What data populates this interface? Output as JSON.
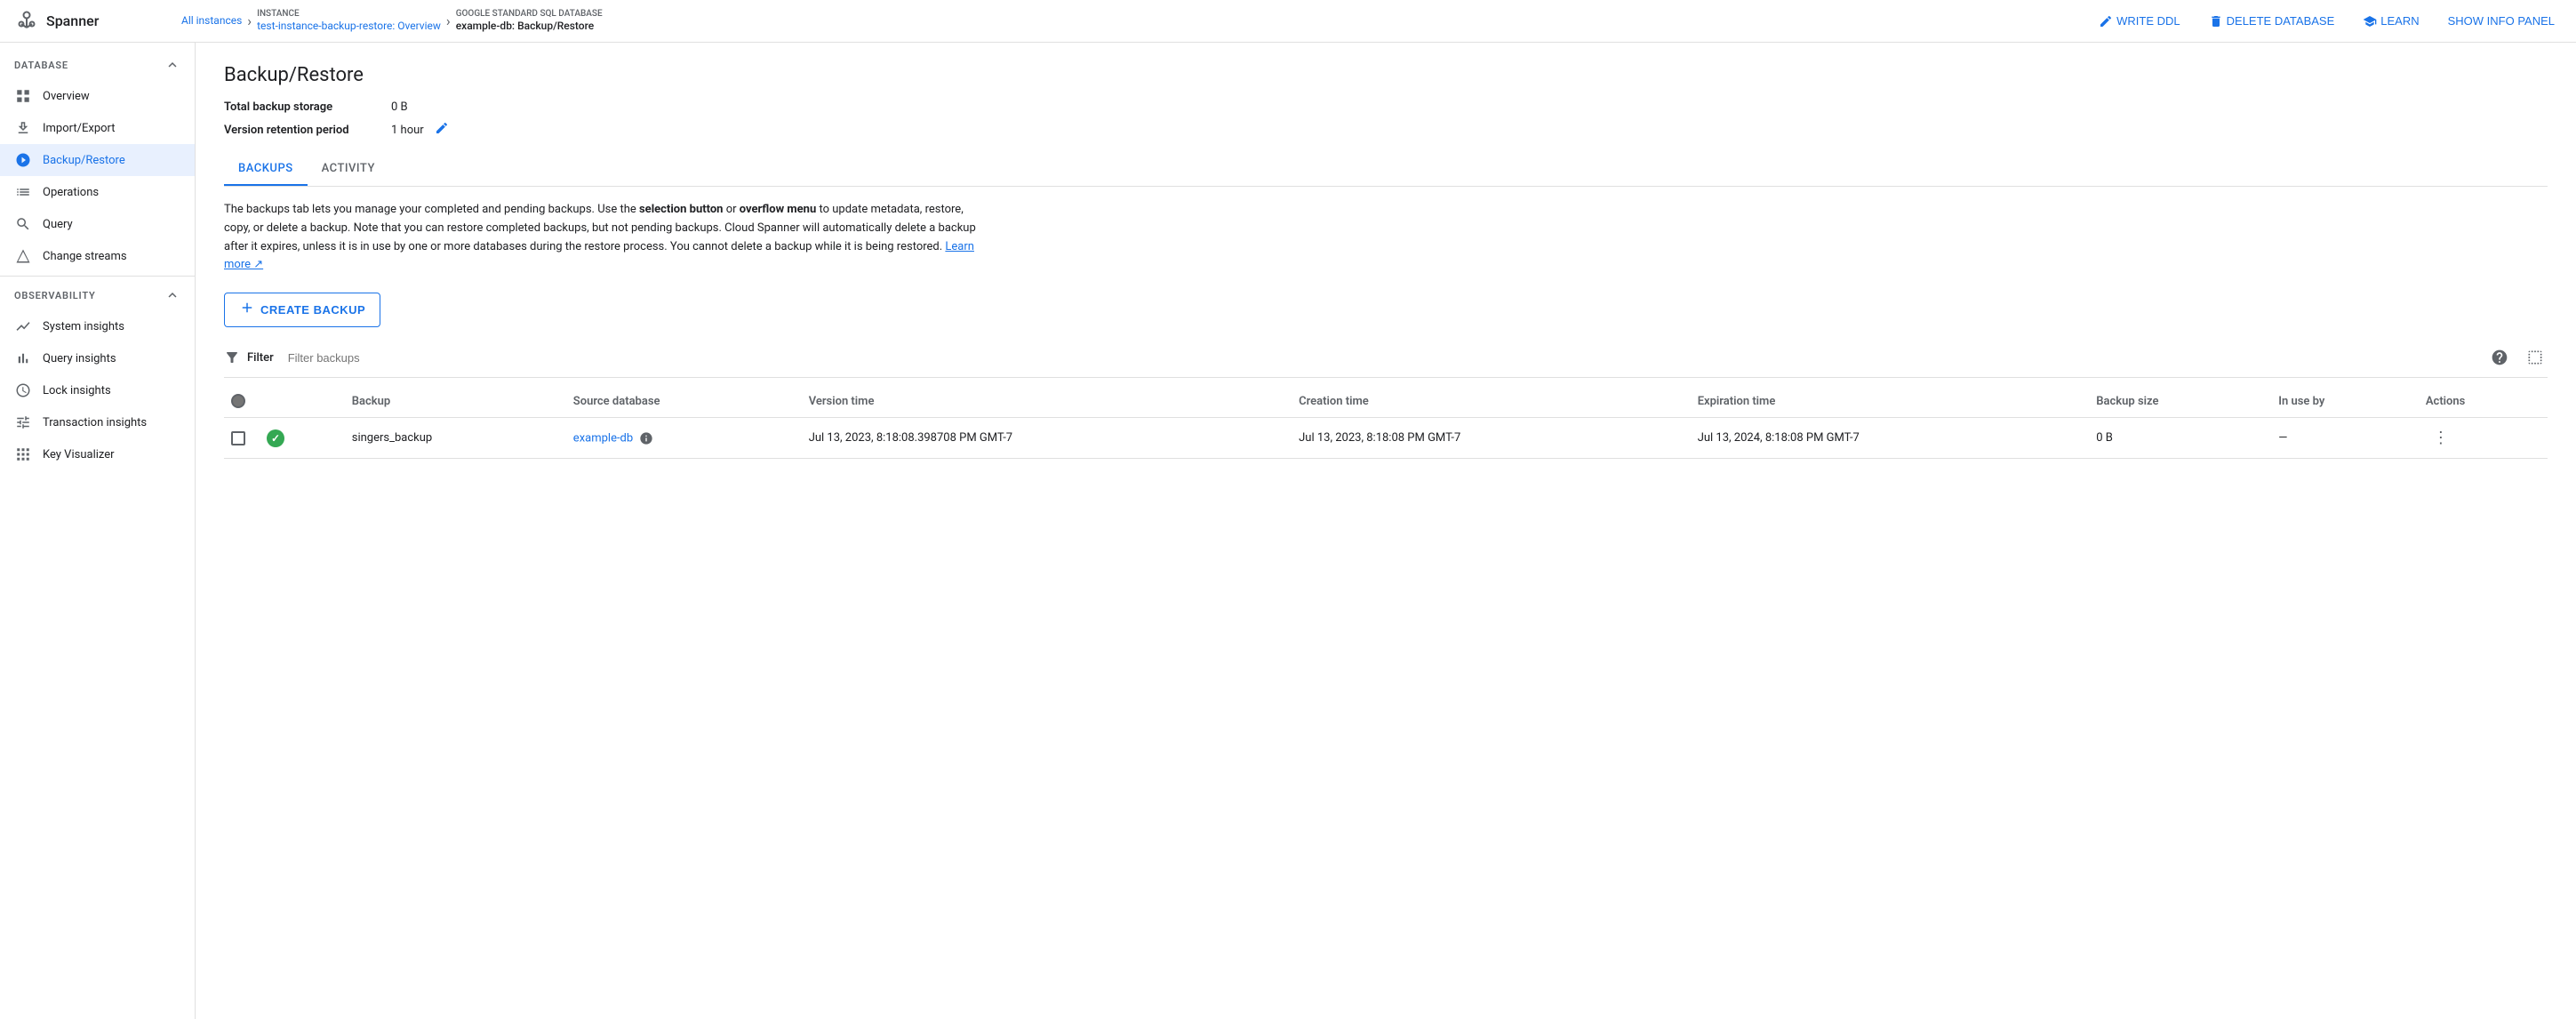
{
  "app": {
    "name": "Spanner"
  },
  "topnav": {
    "breadcrumb": {
      "all_instances_label": "All instances",
      "instance_section_label": "INSTANCE",
      "instance_name": "test-instance-backup-restore: Overview",
      "database_section_label": "GOOGLE STANDARD SQL DATABASE",
      "database_name": "example-db: Backup/Restore"
    },
    "actions": {
      "write_ddl": "WRITE DDL",
      "delete_database": "DELETE DATABASE",
      "learn": "LEARN",
      "show_info_panel": "SHOW INFO PANEL"
    }
  },
  "sidebar": {
    "database_section": "DATABASE",
    "observability_section": "OBSERVABILITY",
    "items_database": [
      {
        "id": "overview",
        "label": "Overview",
        "icon": "grid-icon"
      },
      {
        "id": "import-export",
        "label": "Import/Export",
        "icon": "upload-icon"
      },
      {
        "id": "backup-restore",
        "label": "Backup/Restore",
        "icon": "database-icon",
        "active": true
      },
      {
        "id": "operations",
        "label": "Operations",
        "icon": "list-icon"
      },
      {
        "id": "query",
        "label": "Query",
        "icon": "search-icon"
      },
      {
        "id": "change-streams",
        "label": "Change streams",
        "icon": "triangle-icon"
      }
    ],
    "items_observability": [
      {
        "id": "system-insights",
        "label": "System insights",
        "icon": "chart-icon"
      },
      {
        "id": "query-insights",
        "label": "Query insights",
        "icon": "bar-chart-icon"
      },
      {
        "id": "lock-insights",
        "label": "Lock insights",
        "icon": "clock-icon"
      },
      {
        "id": "transaction-insights",
        "label": "Transaction insights",
        "icon": "sliders-icon"
      },
      {
        "id": "key-visualizer",
        "label": "Key Visualizer",
        "icon": "grid-small-icon"
      }
    ]
  },
  "page": {
    "title": "Backup/Restore",
    "meta": {
      "total_backup_label": "Total backup storage",
      "total_backup_value": "0 B",
      "version_retention_label": "Version retention period",
      "version_retention_value": "1 hour"
    },
    "tabs": [
      {
        "id": "backups",
        "label": "BACKUPS",
        "active": true
      },
      {
        "id": "activity",
        "label": "ACTIVITY",
        "active": false
      }
    ],
    "info_text_part1": "The backups tab lets you manage your completed and pending backups. Use the ",
    "info_bold1": "selection button",
    "info_text_part2": " or ",
    "info_bold2": "overflow menu",
    "info_text_part3": " to update metadata, restore, copy, or delete a backup. Note that you can restore completed backups, but not pending backups. Cloud Spanner will automatically delete a backup after it expires, unless it is in use by one or more databases during the restore process. You cannot delete a backup while it is being restored. ",
    "info_learn_more": "Learn more",
    "create_backup_label": "CREATE BACKUP",
    "filter": {
      "label": "Filter",
      "placeholder": "Filter backups"
    },
    "table": {
      "columns": [
        "Backup",
        "Source database",
        "Version time",
        "Creation time",
        "Expiration time",
        "Backup size",
        "In use by",
        "Actions"
      ],
      "rows": [
        {
          "id": "singers_backup",
          "backup_name": "singers_backup",
          "source_database": "example-db",
          "version_time": "Jul 13, 2023, 8:18:08.398708 PM GMT-7",
          "creation_time": "Jul 13, 2023, 8:18:08 PM GMT-7",
          "expiration_time": "Jul 13, 2024, 8:18:08 PM GMT-7",
          "backup_size": "0 B",
          "in_use_by": "—",
          "status": "success"
        }
      ]
    }
  }
}
